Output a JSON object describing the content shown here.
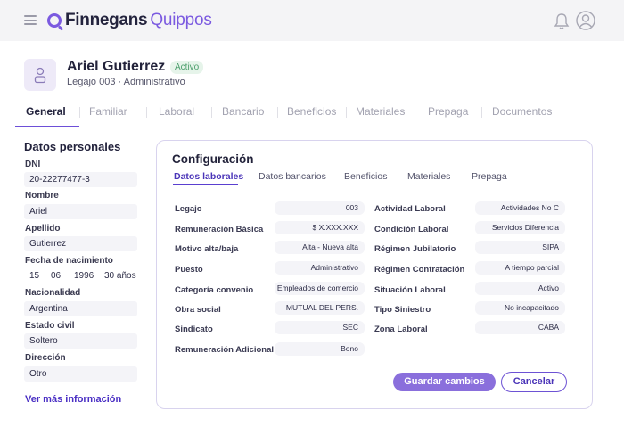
{
  "app": {
    "brand_primary": "Finnegans",
    "brand_secondary": "Quippos",
    "accent": "#7b5ae0"
  },
  "employee": {
    "name": "Ariel Gutierrez",
    "status": "Activo",
    "subline": "Legajo 003 · Administrativo"
  },
  "tabs": [
    {
      "label": "General",
      "active": true
    },
    {
      "label": "Familiar"
    },
    {
      "label": "Laboral"
    },
    {
      "label": "Bancario"
    },
    {
      "label": "Beneficios"
    },
    {
      "label": "Materiales"
    },
    {
      "label": "Prepaga"
    },
    {
      "label": "Documentos"
    }
  ],
  "personal": {
    "title": "Datos personales",
    "dni_label": "DNI",
    "dni": "20-22277477-3",
    "nombre_label": "Nombre",
    "nombre": "Ariel",
    "apellido_label": "Apellido",
    "apellido": "Gutierrez",
    "fecha_label": "Fecha de nacimiento",
    "fecha_dia": "15",
    "fecha_mes": "06",
    "fecha_anio": "1996",
    "edad": "30 años",
    "nacionalidad_label": "Nacionalidad",
    "nacionalidad": "Argentina",
    "estado_label": "Estado civil",
    "estado": "Soltero",
    "direccion_label": "Dirección",
    "direccion": "Otro",
    "ver_mas": "Ver más información"
  },
  "config": {
    "title": "Configuración",
    "sub_tabs": [
      "Datos laborales",
      "Datos bancarios",
      "Beneficios",
      "Materiales",
      "Prepaga"
    ],
    "left_rows": [
      {
        "label": "Legajo",
        "value": "003"
      },
      {
        "label": "Remuneración Básica",
        "value": "$ X.XXX.XXX"
      },
      {
        "label": "Motivo alta/baja",
        "value": "Alta - Nueva alta"
      },
      {
        "label": "Puesto",
        "value": "Administrativo"
      },
      {
        "label": "Categoría convenio",
        "value": "Empleados de comercio"
      },
      {
        "label": "Obra social",
        "value": "MUTUAL DEL PERS."
      },
      {
        "label": "Sindicato",
        "value": "SEC"
      },
      {
        "label": "Remuneración Adicional",
        "value": "Bono"
      }
    ],
    "right_rows": [
      {
        "label": "Actividad Laboral",
        "value": "Actividades No C"
      },
      {
        "label": "Condición Laboral",
        "value": "Servicios Diferencia"
      },
      {
        "label": "Régimen Jubilatorio",
        "value": "SIPA"
      },
      {
        "label": "Régimen Contratación",
        "value": "A tiempo parcial"
      },
      {
        "label": "Situación Laboral",
        "value": "Activo"
      },
      {
        "label": "Tipo Siniestro",
        "value": "No incapacitado"
      },
      {
        "label": "Zona Laboral",
        "value": "CABA"
      }
    ],
    "save_label": "Guardar cambios",
    "cancel_label": "Cancelar"
  }
}
